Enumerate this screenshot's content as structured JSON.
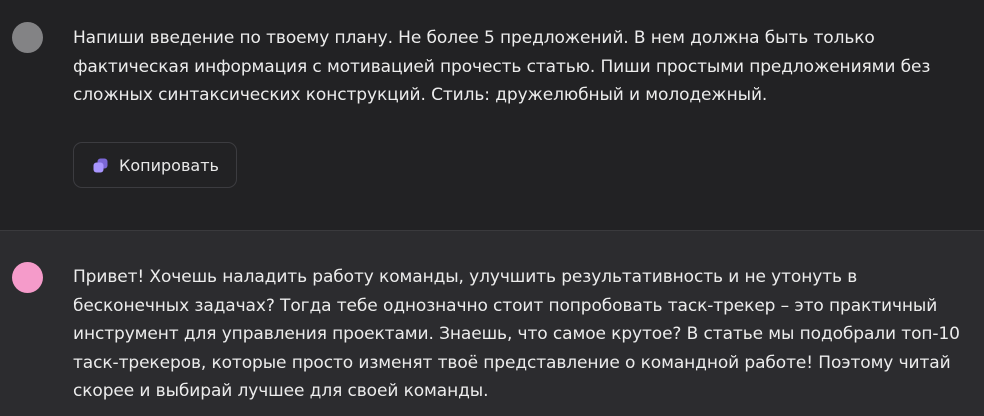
{
  "conversation": {
    "user_message": {
      "text": "Напиши введение по твоему плану. Не более 5 предложений. В нем должна быть только фактическая информация с мотивацией прочесть статью. Пиши простыми предложениями без сложных синтаксических конструкций. Стиль: дружелюбный и молодежный.",
      "avatar_color": "#838385"
    },
    "copy_button": {
      "label": "Копировать",
      "icon": "copy-icon",
      "icon_color": "#9b86f0"
    },
    "assistant_message": {
      "text": "Привет! Хочешь наладить работу команды, улучшить результативность и не утонуть в бесконечных задачах? Тогда тебе однозначно стоит попробовать таск-трекер – это практичный инструмент для управления проектами. Знаешь, что самое крутое? В статье мы подобрали топ-10 таск-трекеров, которые просто изменят твоё представление о командной работе! Поэтому читай скорее и выбирай лучшее для своей команды.",
      "avatar_color": "#f59bca"
    }
  }
}
